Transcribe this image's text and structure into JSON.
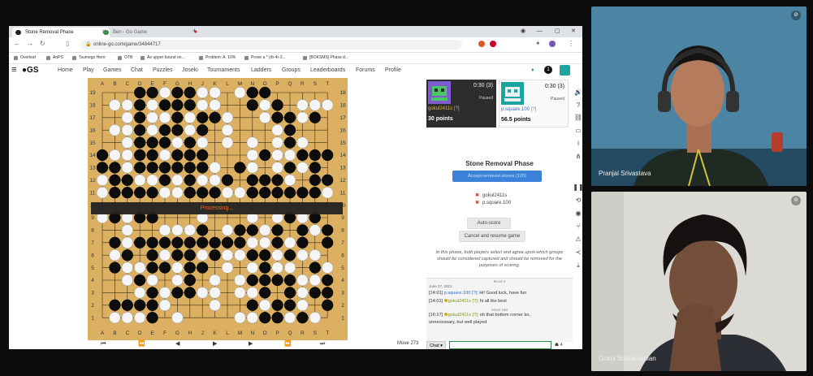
{
  "browser": {
    "tabs": [
      {
        "label": "Stone Removal Phase",
        "active": true
      },
      {
        "label": "Ben - Go Game",
        "active": false
      }
    ],
    "url": "online-go.com/game/34844717",
    "bookmarks": [
      "Overleaf",
      "AoPS",
      "Tsumego Hero",
      "OTB",
      "Ae upper bound on...",
      "Problem: A. 10%",
      "Prove a * (rb-4r-2...",
      "[BOKSMS] Phase d..."
    ]
  },
  "site": {
    "logo": "GS",
    "nav": [
      "Home",
      "Play",
      "Games",
      "Chat",
      "Puzzles",
      "Joseki",
      "Tournaments",
      "Ladders",
      "Groups",
      "Leaderboards",
      "Forums",
      "Profile"
    ],
    "notification_count": "1"
  },
  "board": {
    "columns": [
      "A",
      "B",
      "C",
      "D",
      "E",
      "F",
      "G",
      "H",
      "J",
      "K",
      "L",
      "M",
      "N",
      "O",
      "P",
      "Q",
      "R",
      "S",
      "T"
    ],
    "rows": [
      "19",
      "18",
      "17",
      "16",
      "15",
      "14",
      "13",
      "12",
      "11",
      "10",
      "9",
      "8",
      "7",
      "6",
      "5",
      "4",
      "3",
      "2",
      "1"
    ],
    "position": [
      "...BBWBBWW.WBB.....",
      ".WWBWBBBWW..BWB.WWW",
      "..WBWWBWBBW..WBBWB.",
      ".WWBWBBWB.W...WB...",
      "..WBBBWBW.W.W.WBW..",
      "BWWBBWBBB...WBWWBBB",
      "BBWBBBBBBW.BW.WBWB.",
      "WBBWWBWBWWB.BBBW.BB",
      "WBBBBWWBBBWWBBBBBBW",
      "...................",
      "WBWBB...W...W.WBWB.",
      "..W..WWWB.WBBWB.BWB",
      ".BWBBBBBBBBBWWBWB.B",
      ".WB.BWBBWBWWBBWBWW.",
      ".BWWBBWBB.W.WBWW.BW",
      "..WBW.WB.W.WBBBBWWB",
      "...WBWBBWW.WWB.BWBB",
      ".BBBBW...W..BWBBW.B",
      ".WWWB.W....WWBBWBW."
    ],
    "processing_text": "Processing...",
    "controls": [
      "⏮",
      "⏪",
      "◀",
      "▶",
      "▶",
      "⏩",
      "⏭"
    ],
    "move_label": "Move 273"
  },
  "players": [
    {
      "name": "gokul2411s",
      "rank": "[?]",
      "time": "0:30",
      "periods": "(3)",
      "status": "Paused",
      "points": "30 points"
    },
    {
      "name": "p.square.100",
      "rank": "[?]",
      "time": "0:30",
      "periods": "(3)",
      "status": "Paused",
      "points": "56.5 points"
    }
  ],
  "phase": {
    "title": "Stone Removal Phase",
    "accept_label": "Accept removed stones (120)",
    "acceptances": [
      "gokul2411s",
      "p.square.100"
    ],
    "auto_score_label": "Auto-score",
    "cancel_label": "Cancel and resume game",
    "explanation": "In this phase, both players select and agree upon which groups should be considered captured and should be removed for the purposes of scoring."
  },
  "chat": {
    "header": "Move 4",
    "date": "June 27, 2021",
    "messages": [
      {
        "time": "[14:01]",
        "user": "p.square.100",
        "rank": "[?]",
        "text": ": Hi! Good luck, have fun"
      },
      {
        "time": "[14:01]",
        "user": "gokul2411s",
        "rank": "[?]",
        "text": ": hi all the best"
      },
      {
        "sep": "Move 168"
      },
      {
        "time": "[16:17]",
        "user": "gokul2411s",
        "rank": "[?]",
        "text": ": oh that bottom corner ko,"
      },
      {
        "cont": "unnecessary, but well played"
      }
    ],
    "channel_label": "Chat ▾",
    "input_value": "",
    "viewer_count": "4"
  },
  "video": {
    "participants": [
      {
        "name": "Pranjal Srivastava"
      },
      {
        "name": "Gokul Subramanian"
      }
    ]
  }
}
